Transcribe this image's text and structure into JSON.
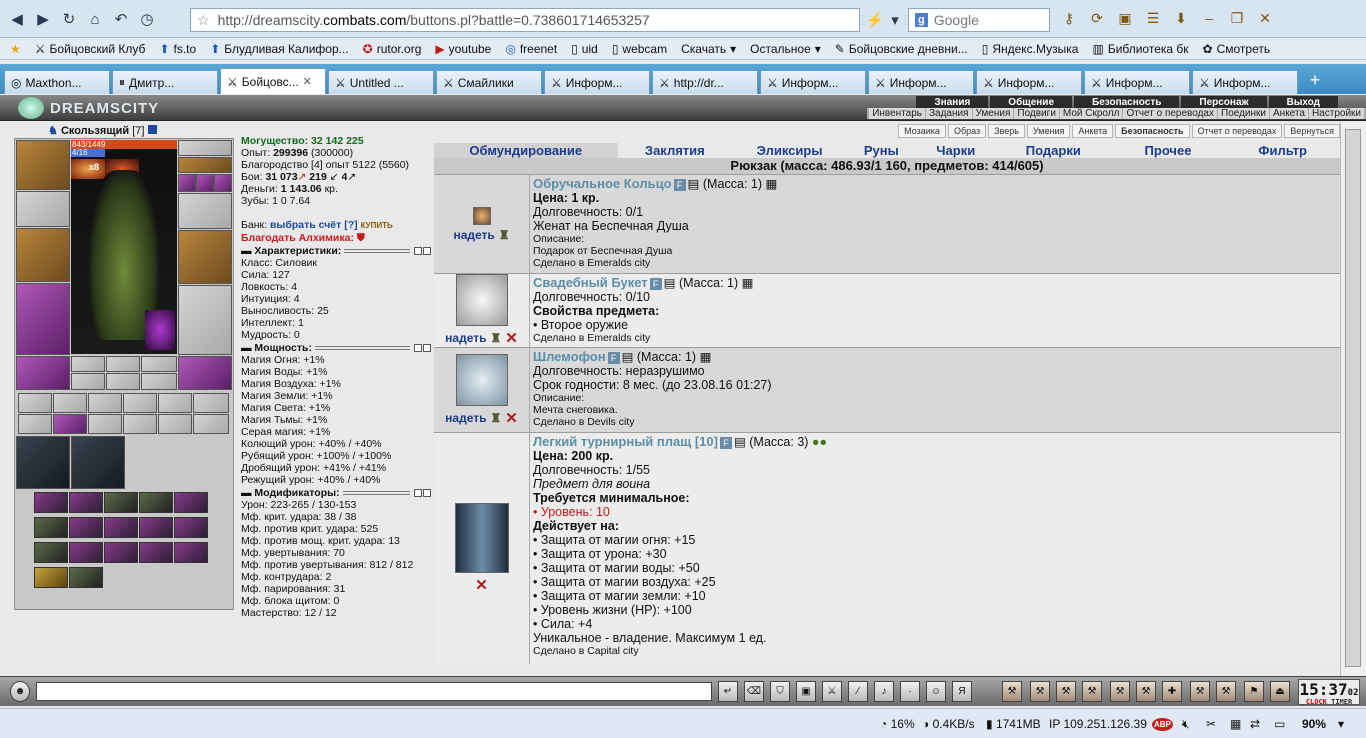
{
  "browser": {
    "url_prefix": "http://dreamscity.",
    "url_domain": "combats.com",
    "url_suffix": "/buttons.pl?battle=0.738601714653257",
    "search_placeholder": "Google"
  },
  "bookmarks": [
    "Бойцовский Клуб",
    "fs.to",
    "Блудливая Калифор...",
    "rutor.org",
    "youtube",
    "freenet",
    "uid",
    "webcam",
    "Скачать",
    "Остальное",
    "Бойцовские дневни...",
    "Яндекс.Музыка",
    "Библиотека бк",
    "Смотреть"
  ],
  "tabs": [
    "Maxthon...",
    "Дмитр...",
    "Бойцовс...",
    "Untitled ...",
    "Смайлики",
    "Информ...",
    "http://dr...",
    "Информ...",
    "Информ...",
    "Информ...",
    "Информ...",
    "Информ..."
  ],
  "game": {
    "logo": "DREAMSCITY",
    "top_menu": [
      "Знания",
      "Общение",
      "Безопасность",
      "Персонаж",
      "Выход"
    ],
    "sub_menu": [
      "Инвентарь",
      "Задания",
      "Умения",
      "Подвиги",
      "Мой Скролл",
      "Отчет о переводах",
      "Поединки",
      "Анкета",
      "Настройки"
    ]
  },
  "character": {
    "name": "Скользящий",
    "level": "[7]",
    "hp": "843/1449",
    "mp": "4/16",
    "stack": "x8"
  },
  "stats": {
    "power": "Могущество: 32 142 225",
    "exp_label": "Опыт:",
    "exp": "299396",
    "exp_next": "(300000)",
    "nobility": "Благородство [4] опыт 5122 (5560)",
    "fights_label": "Бои:",
    "fights": "31 073",
    "wins": "219",
    "draws": "4",
    "money_label": "Деньги:",
    "money": "1 143.06",
    "money_unit": "кр.",
    "teeth": "Зубы: 1 0 7.64",
    "bank_label": "Банк:",
    "bank_link": "выбрать счёт",
    "bank_help": "[?]",
    "buy": "КУПИТЬ",
    "blessing": "Благодать Алхимика:",
    "sec_characteristics": "Характеристики:",
    "characteristics": [
      "Класс: Силовик",
      "Сила: 127",
      "Ловкость: 4",
      "Интуиция: 4",
      "Выносливость: 25",
      "Интеллект: 1",
      "Мудрость: 0"
    ],
    "sec_power": "Мощность:",
    "power_lines": [
      "Магия Огня: +1%",
      "Магия Воды: +1%",
      "Магия Воздуха: +1%",
      "Магия Земли: +1%",
      "Магия Света: +1%",
      "Магия Тьмы: +1%",
      "Серая магия: +1%",
      "Колющий урон: +40% / +40%",
      "Рубящий урон: +100% / +100%",
      "Дробящий урон: +41% / +41%",
      "Режущий урон: +40% / +40%"
    ],
    "sec_modifiers": "Модификаторы:",
    "modifiers": [
      "Урон: 223-265 / 130-153",
      "Мф. крит. удара: 38 / 38",
      "Мф. против крит. удара: 525",
      "Мф. против мощ. крит. удара: 13",
      "Мф. увертывания: 70",
      "Мф. против увертывания: 812 / 812",
      "Мф. контрудара: 2",
      "Мф. парирования: 31",
      "Мф. блока щитом: 0",
      "Мастерство: 12 / 12"
    ]
  },
  "inventory": {
    "subtabs": [
      "Мозаика",
      "Образ",
      "Зверь",
      "Умения",
      "Анкета",
      "Безопасность",
      "Отчет о переводах",
      "Вернуться"
    ],
    "categories": [
      "Обмундирование",
      "Заклятия",
      "Эликсиры",
      "Руны",
      "Чарки",
      "Подарки",
      "Прочее",
      "Фильтр"
    ],
    "title": "Рюкзак (масса: 486.93/1 160, предметов: 414/605)",
    "wear": "надеть",
    "items": [
      {
        "name": "Обручальное Кольцо",
        "mass": "(Масса: 1)",
        "lines": [
          "Цена: 1 кр.",
          "Долговечность: 0/1",
          "Женат на Беспечная Душа"
        ],
        "small": [
          "Описание:",
          "Подарок от Беспечная Душа",
          "Сделано в Emeralds city"
        ]
      },
      {
        "name": "Свадебный Букет",
        "mass": "(Масса: 1)",
        "lines": [
          "Долговечность: 0/10",
          "Свойства предмета:",
          "• Второе оружие"
        ],
        "small": [
          "Сделано в Emeralds city"
        ]
      },
      {
        "name": "Шлемофон",
        "mass": "(Масса: 1)",
        "lines": [
          "Долговечность: неразрушимо",
          "Срок годности: 8 мес. (до 23.08.16 01:27)"
        ],
        "small": [
          "Описание:",
          "Мечта снеговика.",
          "Сделано в Devils city"
        ]
      },
      {
        "name": "Легкий турнирный плащ [10]",
        "mass": "(Масса: 3)",
        "price": "Цена: 200 кр.",
        "durability": "Долговечность: 1/55",
        "note": "Предмет для воина",
        "req_title": "Требуется минимальное:",
        "req": "• Уровень: 10",
        "acts_title": "Действует на:",
        "acts": [
          "• Защита от магии огня: +15",
          "• Защита от урона: +30",
          "• Защита от магии воды: +50",
          "• Защита от магии воздуха: +25",
          "• Защита от магии земли: +10",
          "• Уровень жизни (HP): +100",
          "• Сила: +4"
        ],
        "unique": "Уникальное - владение. Максимум 1 ед.",
        "made": "Сделано в Capital city"
      }
    ]
  },
  "clock": {
    "time": "15:37",
    "sec": "02",
    "label_clock": "CLOCK",
    "label_timer": "TIMER"
  },
  "statusbar": {
    "cpu": "16%",
    "net": "0.4KB/s",
    "mem": "1741MB",
    "ip": "IP 109.251.126.39",
    "zoom": "90%",
    "abp": "ABP"
  }
}
